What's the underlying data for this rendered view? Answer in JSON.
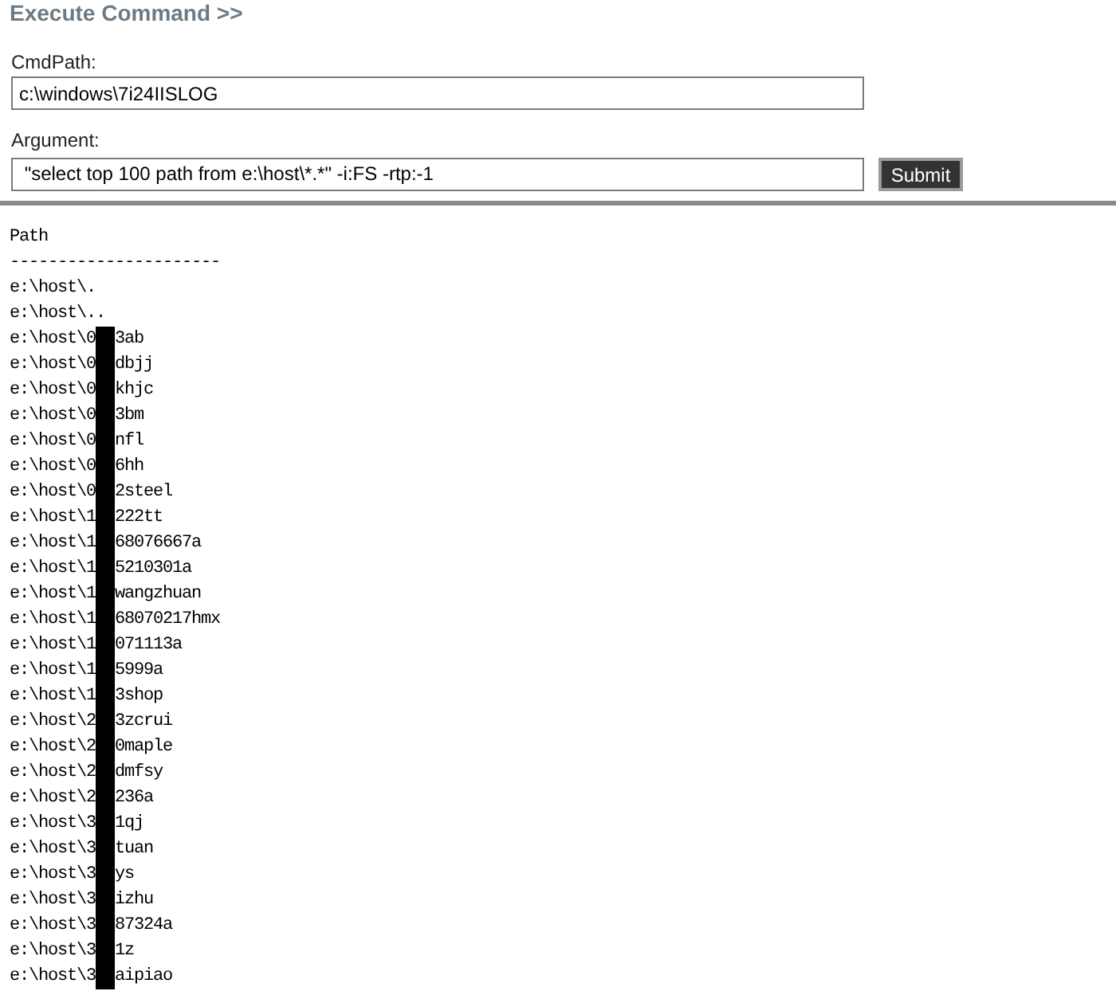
{
  "title": "Execute Command >>",
  "fields": [
    {
      "label": "CmdPath:",
      "value": "c:\\windows\\7i24IISLOG"
    },
    {
      "label": "Argument:",
      "value": " \"select top 100 path from e:\\host\\*.*\" -i:FS -rtp:-1",
      "button": "Submit"
    }
  ],
  "output": {
    "header": "Path",
    "rule": "----------------------",
    "rows": [
      {
        "text": "e:\\host\\."
      },
      {
        "text": "e:\\host\\.."
      },
      {
        "text": "e:\\host\\0",
        "text_after": "3ab"
      },
      {
        "text": "e:\\host\\0",
        "text_after": "dbjj"
      },
      {
        "text": "e:\\host\\0",
        "text_after": "khjc"
      },
      {
        "text": "e:\\host\\0",
        "text_after": "3bm"
      },
      {
        "text": "e:\\host\\0",
        "text_after": "nfl"
      },
      {
        "text": "e:\\host\\0",
        "text_after": "6hh"
      },
      {
        "text": "e:\\host\\0",
        "text_after": "2steel"
      },
      {
        "text": "e:\\host\\1",
        "text_after": "222tt"
      },
      {
        "text": "e:\\host\\1",
        "text_after": "68076667a"
      },
      {
        "text": "e:\\host\\1",
        "text_after": "5210301a"
      },
      {
        "text": "e:\\host\\1",
        "text_after": "wangzhuan"
      },
      {
        "text": "e:\\host\\1",
        "text_after": "68070217hmx"
      },
      {
        "text": "e:\\host\\1",
        "text_after": "071113a"
      },
      {
        "text": "e:\\host\\1",
        "text_after": "5999a"
      },
      {
        "text": "e:\\host\\1",
        "text_after": "3shop"
      },
      {
        "text": "e:\\host\\2",
        "text_after": "3zcrui"
      },
      {
        "text": "e:\\host\\2",
        "text_after": "0maple"
      },
      {
        "text": "e:\\host\\2",
        "text_after": "dmfsy"
      },
      {
        "text": "e:\\host\\2",
        "text_after": "236a"
      },
      {
        "text": "e:\\host\\3",
        "text_after": "1qj"
      },
      {
        "text": "e:\\host\\3",
        "text_after": "tuan"
      },
      {
        "text": "e:\\host\\3",
        "text_after": "ys"
      },
      {
        "text": "e:\\host\\3",
        "text_after": "izhu"
      },
      {
        "text": "e:\\host\\3",
        "text_after": "87324a"
      },
      {
        "text": "e:\\host\\3",
        "text_after": "1z"
      },
      {
        "text": "e:\\host\\3",
        "text_after": "aipiao"
      }
    ]
  }
}
